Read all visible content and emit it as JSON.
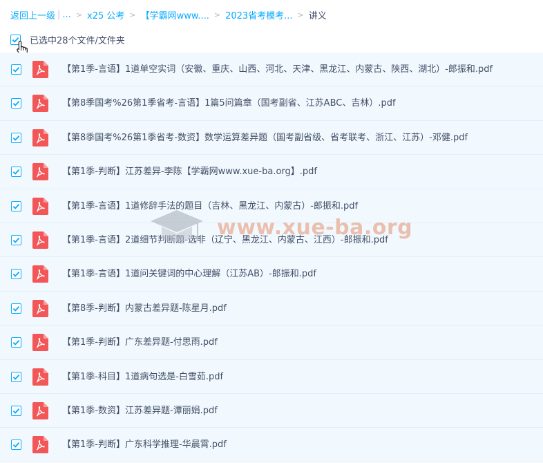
{
  "breadcrumb": {
    "back": "返回上一级",
    "sep": "|",
    "ellipsis": "...",
    "chevron": ">",
    "crumbs": [
      "x25 公考",
      "【学霸网www....",
      "2023省考模考..."
    ],
    "current": "讲义"
  },
  "selection": {
    "label": "已选中28个文件/文件夹",
    "checked": true
  },
  "files": [
    {
      "name": "【第1季-言语】1道单空实词（安徽、重庆、山西、河北、天津、黑龙江、内蒙古、陕西、湖北）-郎振和.pdf",
      "checked": true
    },
    {
      "name": "【第8季国考%26第1季省考-言语】1篇5问篇章（国考副省、江苏ABC、吉林）.pdf",
      "checked": true
    },
    {
      "name": "【第8季国考%26第1季省考-数资】数学运算差异题（国考副省级、省考联考、浙江、江苏）-邓健.pdf",
      "checked": true
    },
    {
      "name": "【第1季-判断】江苏差异-李陈【学霸网www.xue-ba.org】.pdf",
      "checked": true
    },
    {
      "name": "【第1季-言语】1道修辞手法的题目（吉林、黑龙江、内蒙古）-郎振和.pdf",
      "checked": true
    },
    {
      "name": "【第1季-言语】2道细节判断题-选非（辽宁、黑龙江、内蒙古、江西）-郎振和.pdf",
      "checked": true
    },
    {
      "name": "【第1季-言语】1道问关键词的中心理解（江苏AB）-郎振和.pdf",
      "checked": true
    },
    {
      "name": "【第8季-判断】内蒙古差异题-陈星月.pdf",
      "checked": true
    },
    {
      "name": "【第1季-判断】广东差异题-付思雨.pdf",
      "checked": true
    },
    {
      "name": "【第1季-科目】1道病句选是-白雪茹.pdf",
      "checked": true
    },
    {
      "name": "【第1季-数资】江苏差异题-谭丽娟.pdf",
      "checked": true
    },
    {
      "name": "【第1季-判断】广东科学推理-华晨霄.pdf",
      "checked": true
    }
  ],
  "watermark": {
    "text": "www.xue-ba.org",
    "icon": "graduation-cap-icon"
  },
  "colors": {
    "accent": "#09aaff",
    "row_bg": "#f1f9fe",
    "pdf_red": "#f25656",
    "text": "#424e67"
  },
  "icons": {
    "file": "pdf-icon",
    "check": "checkmark-icon",
    "cursor": "hand-pointer-icon"
  }
}
